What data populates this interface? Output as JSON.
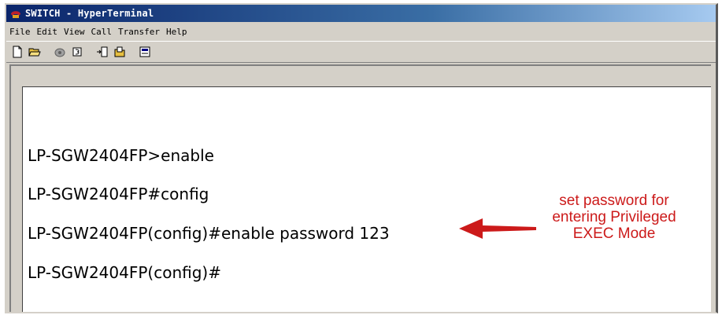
{
  "window": {
    "title": "SWITCH - HyperTerminal",
    "app_icon": "hyperterminal-phone-icon"
  },
  "menu": {
    "items": [
      "File",
      "Edit",
      "View",
      "Call",
      "Transfer",
      "Help"
    ]
  },
  "toolbar": {
    "buttons": [
      "new-icon",
      "open-icon",
      "dial-icon",
      "disconnect-icon",
      "send-icon",
      "receive-icon",
      "properties-icon"
    ]
  },
  "terminal": {
    "lines": [
      "LP-SGW2404FP>enable",
      "LP-SGW2404FP#config",
      "LP-SGW2404FP(config)#enable password 123",
      "LP-SGW2404FP(config)#"
    ]
  },
  "annotation": {
    "lines": [
      "set password for",
      "entering Privileged",
      "EXEC Mode"
    ],
    "color": "#cc1a1a"
  }
}
